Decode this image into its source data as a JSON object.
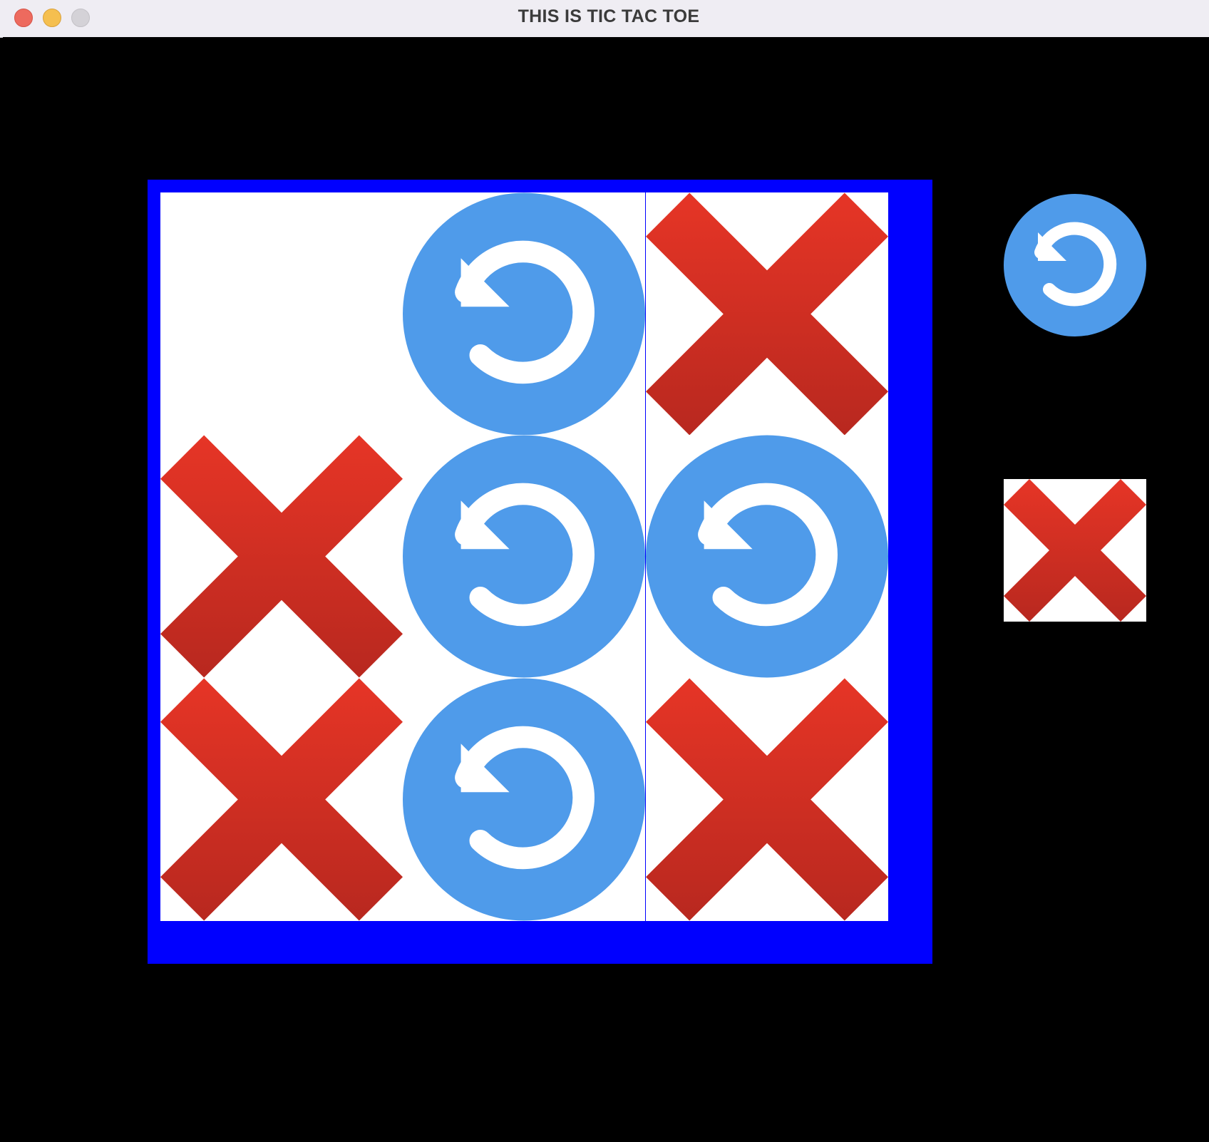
{
  "window": {
    "title": "THIS IS TIC TAC TOE"
  },
  "colors": {
    "background": "#000000",
    "grid": "#0000ff",
    "cell": "#ffffff",
    "o_mark": "#4f9bea",
    "x_mark_top": "#e63526",
    "x_mark_bottom": "#b8281f"
  },
  "board": {
    "cells": [
      "",
      "O",
      "X",
      "X",
      "O",
      "O",
      "X",
      "O",
      "X"
    ]
  },
  "sidebar": {
    "o_piece": "O",
    "x_piece": "X"
  },
  "icons": {
    "o_icon": "undo-arrow-circle-icon",
    "x_icon": "red-x-cross-icon"
  }
}
